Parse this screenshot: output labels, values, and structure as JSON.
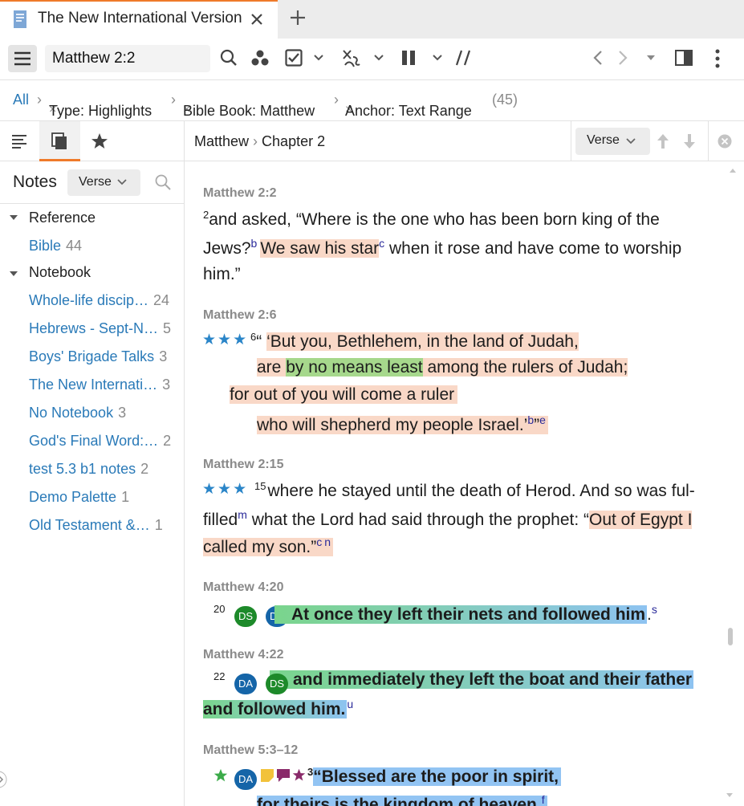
{
  "tab": {
    "title": "The New International Version"
  },
  "toolbar": {
    "reference_value": "Matthew 2:2"
  },
  "filter": {
    "all": "All",
    "chip1": "Type: Highlights",
    "chip2": "Bible Book: Matthew",
    "chip3": "Anchor: Text Range",
    "count": "(45)"
  },
  "sidebar": {
    "title": "Notes",
    "view": "Verse",
    "groups": [
      {
        "label": "Reference",
        "items": [
          {
            "label": "Bible",
            "count": "44"
          }
        ]
      },
      {
        "label": "Notebook",
        "items": [
          {
            "label": "Whole-life discip…",
            "count": "24"
          },
          {
            "label": "Hebrews - Sept-N…",
            "count": "5"
          },
          {
            "label": "Boys' Brigade Talks",
            "count": "3"
          },
          {
            "label": "The New Internati…",
            "count": "3"
          },
          {
            "label": "No Notebook",
            "count": "3"
          },
          {
            "label": "God's Final Word:…",
            "count": "2"
          },
          {
            "label": "test 5.3 b1 notes",
            "count": "2"
          },
          {
            "label": "Demo Palette",
            "count": "1"
          },
          {
            "label": "Old Testament &…",
            "count": "1"
          }
        ]
      }
    ]
  },
  "main": {
    "crumb_book": "Matthew",
    "crumb_chapter": "Chapter 2",
    "view": "Verse",
    "verses": {
      "v1": {
        "ref": "Matthew 2:2",
        "num": "2",
        "l1": "and  asked, “Where  is  the  one  who  has  been  born  king  of  the",
        "l2a": "Jews?",
        "fn_b": "b",
        "l2_hl": "We saw his star",
        "fn_c": "c",
        "l2b": " when  it  rose  and  have  come  to  worship",
        "l3": "him.”"
      },
      "v2": {
        "ref": "Matthew 2:6",
        "stars": "★★★",
        "num": "6",
        "open": "“ ",
        "l1": "‘But you, Bethlehem, in the land of Judah,",
        "l2a": "are ",
        "l2_hl": "by no means least",
        "l2b": " among the rulers of Judah;",
        "l3": "for out of you will come a ruler",
        "l4": "who will shepherd my people Israel.’",
        "fn_b": "b",
        "close": "”",
        "fn_e": "e"
      },
      "v3": {
        "ref": "Matthew 2:15",
        "stars": "★★★",
        "num": "15",
        "l1": "where he stayed until the death of Herod. And so was ful-",
        "l2a": "filled",
        "fn_m": "m",
        "l2b": " what the Lord had said through the prophet: “",
        "l2_hl": "Out of Egypt I",
        "l3_hl": "called my son.”",
        "fn_c": "c",
        "fn_n": "n"
      },
      "v4": {
        "ref": "Matthew 4:20",
        "num": "20",
        "badge1": "DS",
        "badge2": "DA",
        "text": "At once they left their nets and followed him",
        "end": ".",
        "fn_s": "s"
      },
      "v5": {
        "ref": "Matthew 4:22",
        "num": "22",
        "badge1": "DA",
        "badge2": "DS",
        "l1": "and  immediately  they  left  the  boat  and  their  father",
        "l2": "and followed him.",
        "fn_u": "u"
      },
      "v6": {
        "ref": "Matthew 5:3–12",
        "badge": "DA",
        "num": "3",
        "l1": "“Blessed are the poor in spirit,",
        "l2": "for theirs is the kingdom of heaven.",
        "fn_f": "f"
      }
    }
  },
  "colors": {
    "accent": "#ef7a2a",
    "link": "#2a7ab8",
    "highlight_orange": "#f9d8c7",
    "highlight_green": "#a6d88c",
    "highlight_blue": "#92c4f3",
    "badge_ds": "#1d8a2a",
    "badge_da": "#1565a8"
  }
}
